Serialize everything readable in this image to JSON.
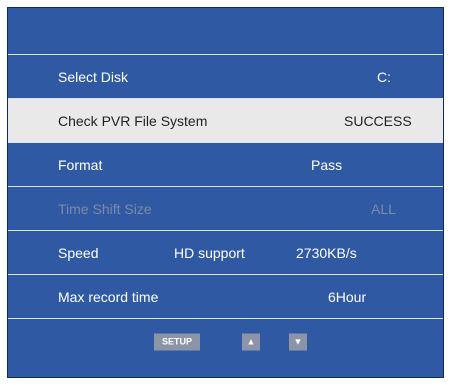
{
  "menu": {
    "select_disk": {
      "label": "Select Disk",
      "value": "C:"
    },
    "check_pvr": {
      "label": "Check PVR File System",
      "value": "SUCCESS"
    },
    "format": {
      "label": "Format",
      "value": "Pass"
    },
    "time_shift": {
      "label": "Time Shift Size",
      "value": "ALL"
    },
    "speed": {
      "label": "Speed",
      "mid": "HD support",
      "value": "2730KB/s"
    },
    "max_record": {
      "label": "Max record time",
      "value": "6Hour"
    }
  },
  "footer": {
    "setup_label": "SETUP",
    "up_symbol": "▲",
    "down_symbol": "▼",
    "up_icon": "arrow-up-icon",
    "down_icon": "arrow-down-icon"
  },
  "colors": {
    "panel": "#2f5aa3",
    "highlight": "#e9e9ea",
    "disabled_text": "#7c8aa7"
  }
}
